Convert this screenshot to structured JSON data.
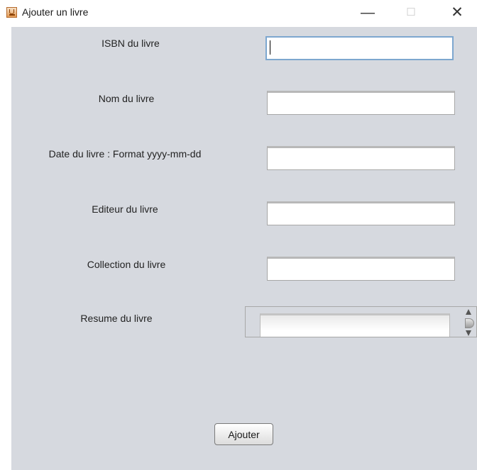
{
  "window": {
    "title": "Ajouter un livre",
    "icon": "java-cup-icon",
    "controls": {
      "minimize": "—",
      "maximize": "☐",
      "close": "✕"
    }
  },
  "form": {
    "isbn": {
      "label": "ISBN du livre",
      "value": ""
    },
    "nom": {
      "label": "Nom du livre",
      "value": ""
    },
    "date": {
      "label": "Date du livre : Format yyyy-mm-dd",
      "value": ""
    },
    "editeur": {
      "label": "Editeur du livre",
      "value": ""
    },
    "collection": {
      "label": "Collection du livre",
      "value": ""
    },
    "resume": {
      "label": "Resume du livre",
      "value": ""
    }
  },
  "actions": {
    "submit_label": "Ajouter"
  },
  "colors": {
    "panel_background": "#d6d9df",
    "focus_border": "#7da7cf"
  }
}
